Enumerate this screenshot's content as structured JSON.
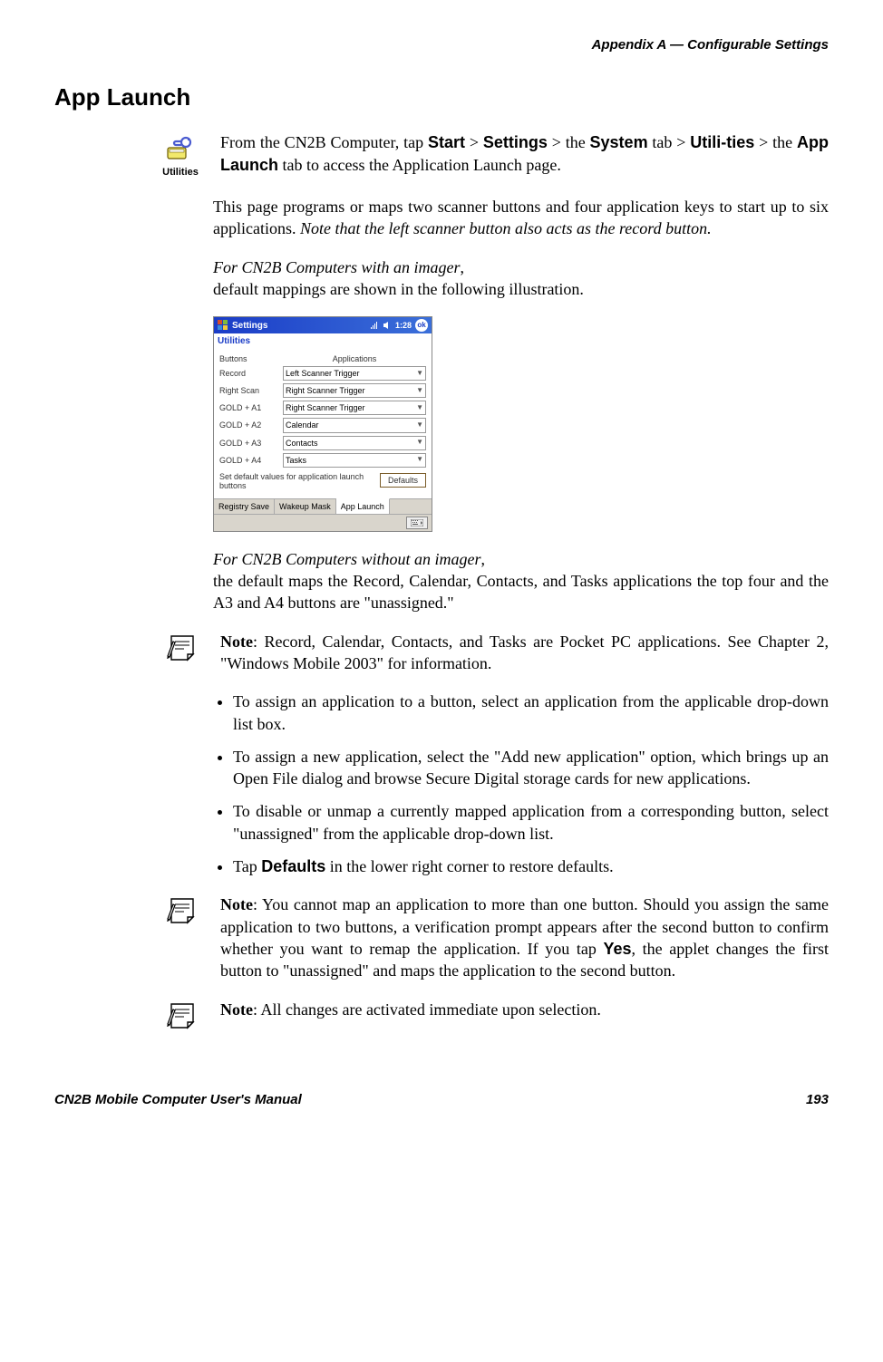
{
  "header": {
    "right": "Appendix A —  Configurable Settings"
  },
  "section_title": "App Launch",
  "utilities_label": "Utilities",
  "intro": {
    "prefix": "From the CN2B Computer, tap ",
    "start": "Start",
    "gt1": " > ",
    "settings": "Settings",
    "gt2": " > the ",
    "system": "System",
    "tab_gt": " tab > ",
    "utilities_hyp1": "Utili-",
    "utilities_hyp2": "ties",
    "gt3": " > the ",
    "applaunch": "App Launch",
    "suffix": " tab to access the Application Launch page."
  },
  "para1": {
    "a": "This page programs or maps two scanner buttons and four application keys to start up to six applications. ",
    "b": "Note that the left scanner button also acts as the record button."
  },
  "para2": {
    "a": "For CN2B Computers with an imager",
    "b": ",",
    "c": "default mappings are shown in the following illustration."
  },
  "ppc": {
    "title": "Settings",
    "clock": "1:28",
    "ok": "ok",
    "subtitle": "Utilities",
    "col_buttons": "Buttons",
    "col_apps": "Applications",
    "rows": [
      {
        "label": "Record",
        "value": "Left Scanner Trigger"
      },
      {
        "label": "Right Scan",
        "value": "Right Scanner Trigger"
      },
      {
        "label": "GOLD + A1",
        "value": "Right Scanner Trigger"
      },
      {
        "label": "GOLD + A2",
        "value": "Calendar"
      },
      {
        "label": "GOLD + A3",
        "value": "Contacts"
      },
      {
        "label": "GOLD + A4",
        "value": "Tasks"
      }
    ],
    "defaults_text": "Set default values for application launch buttons",
    "defaults_btn": "Defaults",
    "tab1": "Registry Save",
    "tab2": "Wakeup Mask",
    "tab3": "App Launch"
  },
  "para3": {
    "a": "For CN2B Computers without an imager",
    "b": ",",
    "c": "the default maps the Record, Calendar, Contacts, and Tasks applications the top four and the A3 and A4 buttons are \"unassigned.\""
  },
  "note1": {
    "prefix": "Note",
    "text": ": Record, Calendar, Contacts, and Tasks are Pocket PC applications. See Chapter 2, \"Windows Mobile 2003\" for information."
  },
  "bullets": {
    "b1": "To assign an application to a button, select an application from the applicable drop-down list box.",
    "b2": "To assign a new application, select the \"Add new application\" option, which brings up an Open File dialog and browse Secure Digital storage cards for new applications.",
    "b3": "To disable or unmap a currently mapped application from a corresponding button, select \"unassigned\" from the applicable drop-down list.",
    "b4a": "Tap ",
    "b4b": "Defaults",
    "b4c": " in the lower right corner to restore defaults."
  },
  "note2": {
    "prefix": "Note",
    "a": ": You cannot map an application to more than one button. Should you assign the same application to two buttons, a verification prompt appears after the second button to confirm whether you want to remap the application. If you tap ",
    "yes": "Yes",
    "b": ", the applet changes the first button to \"unassigned\" and maps the application to the second button."
  },
  "note3": {
    "prefix": "Note",
    "text": ": All changes are activated immediate upon selection."
  },
  "footer": {
    "left": "CN2B Mobile Computer User's Manual",
    "right": "193"
  }
}
